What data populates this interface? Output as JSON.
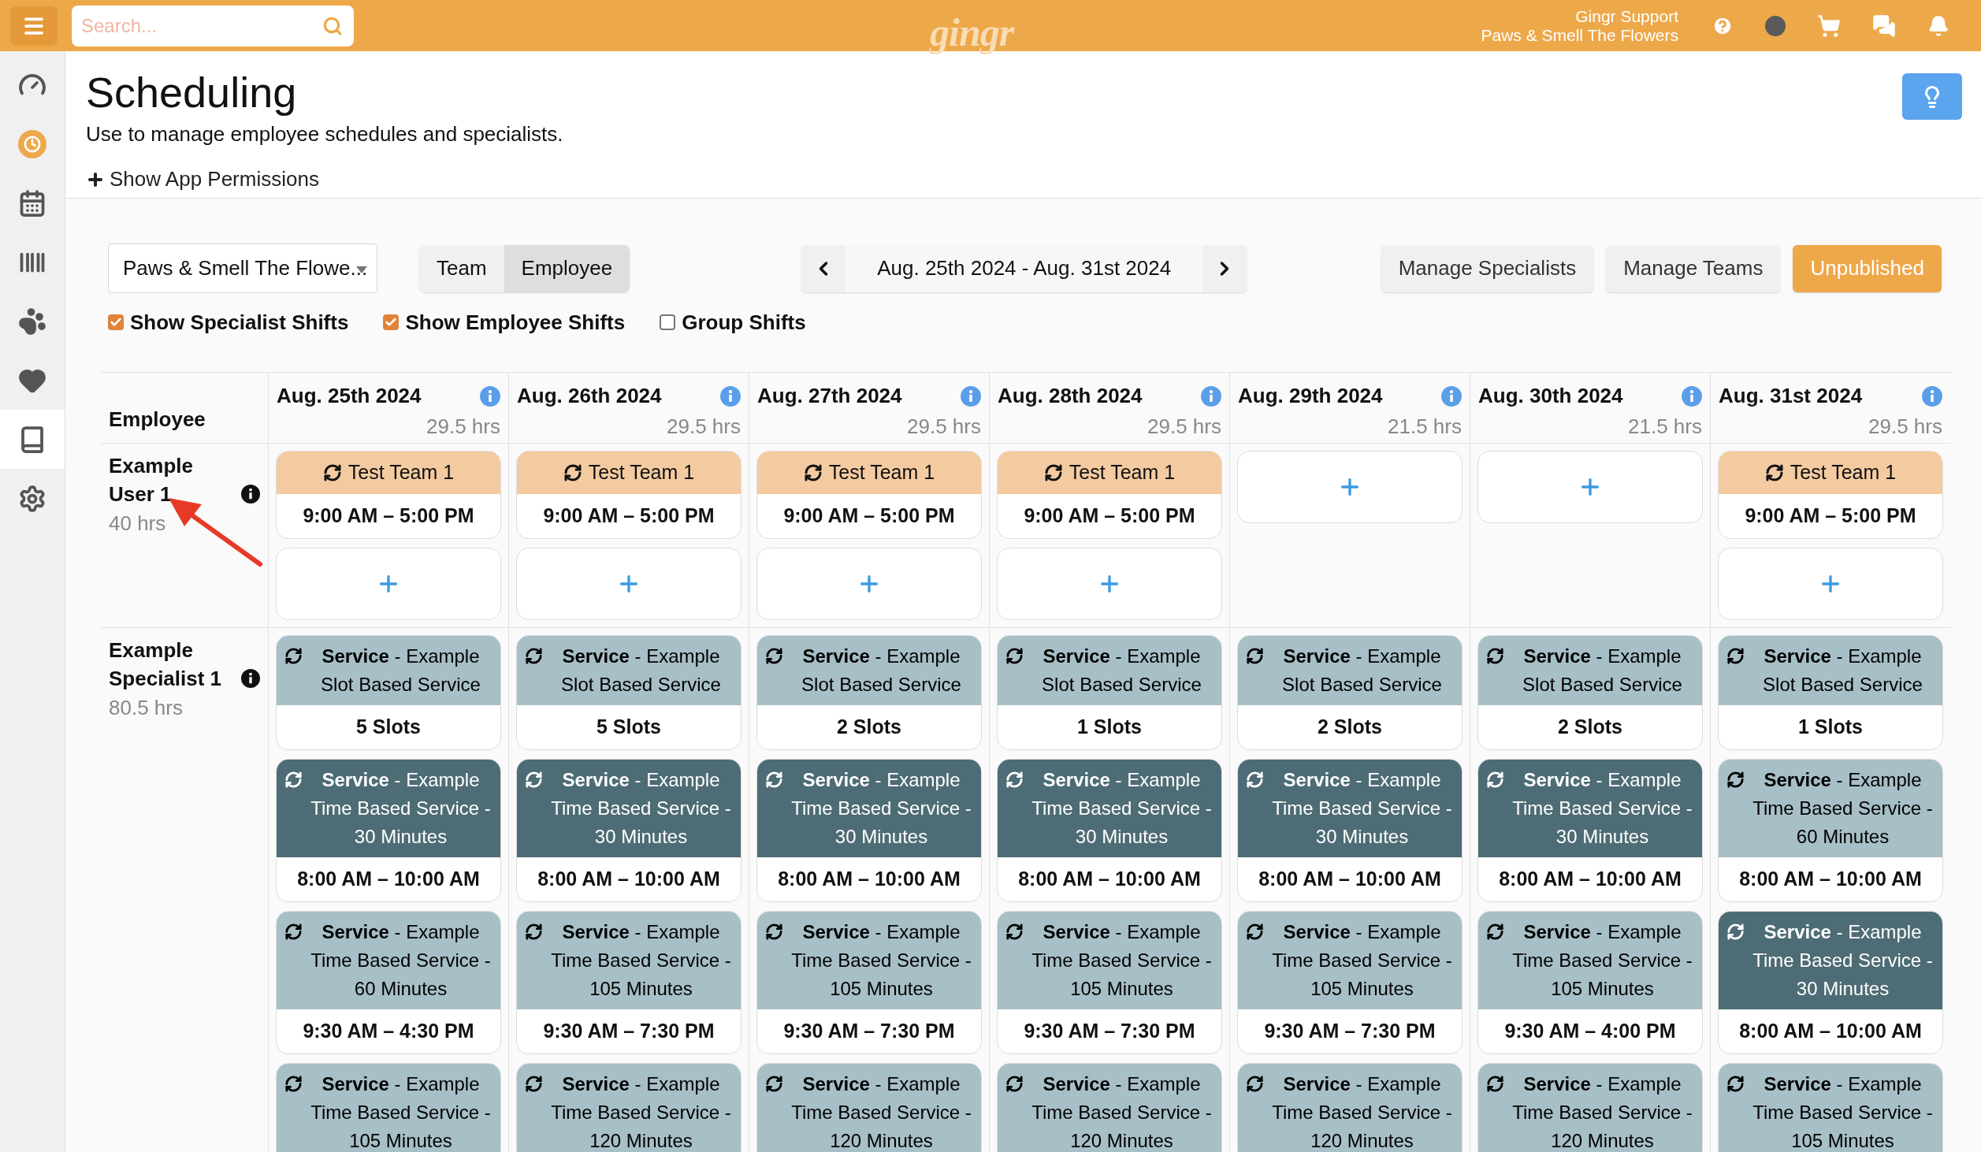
{
  "topbar": {
    "search": {
      "placeholder": "Search..."
    },
    "logo": "gingr",
    "account": {
      "name": "Gingr Support",
      "location": "Paws & Smell The Flowers"
    }
  },
  "sidebar": {
    "items": [
      {
        "kind": "gauge",
        "selected": false,
        "highlighted": false
      },
      {
        "kind": "clock",
        "selected": false,
        "highlighted": true
      },
      {
        "kind": "calendar",
        "selected": false,
        "highlighted": false
      },
      {
        "kind": "barcode",
        "selected": false,
        "highlighted": false
      },
      {
        "kind": "paw",
        "selected": false,
        "highlighted": false
      },
      {
        "kind": "heart",
        "selected": false,
        "highlighted": false
      },
      {
        "kind": "book",
        "selected": true,
        "highlighted": false
      },
      {
        "kind": "gears",
        "selected": false,
        "highlighted": false
      }
    ]
  },
  "page": {
    "title": "Scheduling",
    "subtitle": "Use to manage employee schedules and specialists.",
    "permissions_link": "Show App Permissions"
  },
  "toolbar": {
    "location": "Paws & Smell The Flowe...",
    "view_tabs": [
      {
        "label": "Team",
        "selected": false
      },
      {
        "label": "Employee",
        "selected": true
      }
    ],
    "date_range": "Aug. 25th 2024 - Aug. 31st 2024",
    "buttons": [
      {
        "label": "Manage Specialists",
        "kind": "default"
      },
      {
        "label": "Manage Teams",
        "kind": "default"
      },
      {
        "label": "Unpublished",
        "kind": "warning"
      }
    ]
  },
  "filters": [
    {
      "label": "Show Specialist Shifts",
      "checked": true
    },
    {
      "label": "Show Employee Shifts",
      "checked": true
    },
    {
      "label": "Group Shifts",
      "checked": false
    }
  ],
  "schedule": {
    "employee_heading": "Employee",
    "days": [
      {
        "date": "Aug. 25th 2024",
        "hours": "29.5 hrs"
      },
      {
        "date": "Aug. 26th 2024",
        "hours": "29.5 hrs"
      },
      {
        "date": "Aug. 27th 2024",
        "hours": "29.5 hrs"
      },
      {
        "date": "Aug. 28th 2024",
        "hours": "29.5 hrs"
      },
      {
        "date": "Aug. 29th 2024",
        "hours": "21.5 hrs"
      },
      {
        "date": "Aug. 30th 2024",
        "hours": "21.5 hrs"
      },
      {
        "date": "Aug. 31st 2024",
        "hours": "29.5 hrs"
      }
    ],
    "employees": [
      {
        "name": "Example User 1",
        "hours": "40 hrs",
        "days": [
          [
            {
              "kind": "team",
              "title": "Test Team 1",
              "time": "9:00 AM – 5:00 PM"
            },
            {
              "kind": "add"
            }
          ],
          [
            {
              "kind": "team",
              "title": "Test Team 1",
              "time": "9:00 AM – 5:00 PM"
            },
            {
              "kind": "add"
            }
          ],
          [
            {
              "kind": "team",
              "title": "Test Team 1",
              "time": "9:00 AM – 5:00 PM"
            },
            {
              "kind": "add"
            }
          ],
          [
            {
              "kind": "team",
              "title": "Test Team 1",
              "time": "9:00 AM – 5:00 PM"
            },
            {
              "kind": "add"
            }
          ],
          [
            {
              "kind": "add"
            }
          ],
          [
            {
              "kind": "add"
            }
          ],
          [
            {
              "kind": "team",
              "title": "Test Team 1",
              "time": "9:00 AM – 5:00 PM"
            },
            {
              "kind": "add"
            }
          ]
        ]
      },
      {
        "name": "Example Specialist 1",
        "hours": "80.5 hrs",
        "days": [
          [
            {
              "kind": "service",
              "dark": false,
              "title": "**Service** - Example Slot Based Service",
              "time": "5 Slots"
            },
            {
              "kind": "service",
              "dark": true,
              "title": "**Service** - Example Time Based Service - 30 Minutes",
              "time": "8:00 AM – 10:00 AM"
            },
            {
              "kind": "service",
              "dark": false,
              "title": "**Service** - Example Time Based Service - 60 Minutes",
              "time": "9:30 AM – 4:30 PM"
            },
            {
              "kind": "service",
              "dark": false,
              "title": "**Service** - Example Time Based Service - 105 Minutes"
            }
          ],
          [
            {
              "kind": "service",
              "dark": false,
              "title": "**Service** - Example Slot Based Service",
              "time": "5 Slots"
            },
            {
              "kind": "service",
              "dark": true,
              "title": "**Service** - Example Time Based Service - 30 Minutes",
              "time": "8:00 AM – 10:00 AM"
            },
            {
              "kind": "service",
              "dark": false,
              "title": "**Service** - Example Time Based Service - 105 Minutes",
              "time": "9:30 AM – 7:30 PM"
            },
            {
              "kind": "service",
              "dark": false,
              "title": "**Service** - Example Time Based Service - 120 Minutes"
            }
          ],
          [
            {
              "kind": "service",
              "dark": false,
              "title": "**Service** - Example Slot Based Service",
              "time": "2 Slots"
            },
            {
              "kind": "service",
              "dark": true,
              "title": "**Service** - Example Time Based Service - 30 Minutes",
              "time": "8:00 AM – 10:00 AM"
            },
            {
              "kind": "service",
              "dark": false,
              "title": "**Service** - Example Time Based Service - 105 Minutes",
              "time": "9:30 AM – 7:30 PM"
            },
            {
              "kind": "service",
              "dark": false,
              "title": "**Service** - Example Time Based Service - 120 Minutes"
            }
          ],
          [
            {
              "kind": "service",
              "dark": false,
              "title": "**Service** - Example Slot Based Service",
              "time": "1 Slots"
            },
            {
              "kind": "service",
              "dark": true,
              "title": "**Service** - Example Time Based Service - 30 Minutes",
              "time": "8:00 AM – 10:00 AM"
            },
            {
              "kind": "service",
              "dark": false,
              "title": "**Service** - Example Time Based Service - 105 Minutes",
              "time": "9:30 AM – 7:30 PM"
            },
            {
              "kind": "service",
              "dark": false,
              "title": "**Service** - Example Time Based Service - 120 Minutes"
            }
          ],
          [
            {
              "kind": "service",
              "dark": false,
              "title": "**Service** - Example Slot Based Service",
              "time": "2 Slots"
            },
            {
              "kind": "service",
              "dark": true,
              "title": "**Service** - Example Time Based Service - 30 Minutes",
              "time": "8:00 AM – 10:00 AM"
            },
            {
              "kind": "service",
              "dark": false,
              "title": "**Service** - Example Time Based Service - 105 Minutes",
              "time": "9:30 AM – 7:30 PM"
            },
            {
              "kind": "service",
              "dark": false,
              "title": "**Service** - Example Time Based Service - 120 Minutes"
            }
          ],
          [
            {
              "kind": "service",
              "dark": false,
              "title": "**Service** - Example Slot Based Service",
              "time": "2 Slots"
            },
            {
              "kind": "service",
              "dark": true,
              "title": "**Service** - Example Time Based Service - 30 Minutes",
              "time": "8:00 AM – 10:00 AM"
            },
            {
              "kind": "service",
              "dark": false,
              "title": "**Service** - Example Time Based Service - 105 Minutes",
              "time": "9:30 AM – 4:00 PM"
            },
            {
              "kind": "service",
              "dark": false,
              "title": "**Service** - Example Time Based Service - 120 Minutes"
            }
          ],
          [
            {
              "kind": "service",
              "dark": false,
              "title": "**Service** - Example Slot Based Service",
              "time": "1 Slots"
            },
            {
              "kind": "service",
              "dark": false,
              "title": "**Service** - Example Time Based Service - 60 Minutes",
              "time": "8:00 AM – 10:00 AM"
            },
            {
              "kind": "service",
              "dark": true,
              "title": "**Service** - Example Time Based Service - 30 Minutes",
              "time": "8:00 AM – 10:00 AM"
            },
            {
              "kind": "service",
              "dark": false,
              "title": "**Service** - Example Time Based Service - 105 Minutes"
            }
          ]
        ]
      }
    ]
  }
}
